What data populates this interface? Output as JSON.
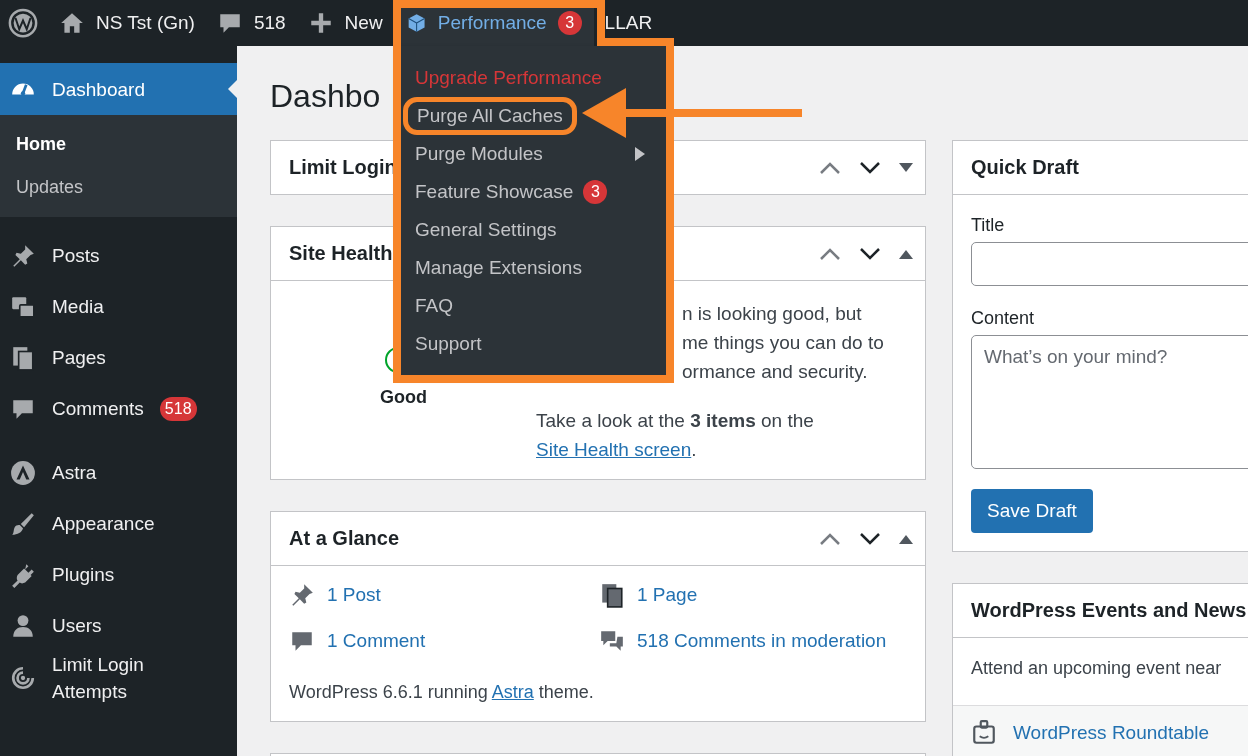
{
  "admin_bar": {
    "items": [
      {
        "kind": "logo"
      },
      {
        "kind": "home",
        "label": "NS Tst (Gn)"
      },
      {
        "kind": "comments",
        "label": "518"
      },
      {
        "kind": "new",
        "label": "New"
      },
      {
        "kind": "performance",
        "label": "Performance",
        "badge": "3"
      },
      {
        "kind": "text",
        "label": "LLAR"
      }
    ]
  },
  "performance_menu": {
    "items": [
      {
        "kind": "upgrade",
        "label": "Upgrade Performance",
        "callout": false
      },
      {
        "kind": "item",
        "label": "Purge All Caches",
        "callout": true
      },
      {
        "kind": "submenu",
        "label": "Purge Modules",
        "callout": false
      },
      {
        "kind": "item",
        "label": "Feature Showcase",
        "badge": "3",
        "callout": false
      },
      {
        "kind": "item",
        "label": "General Settings",
        "callout": false
      },
      {
        "kind": "item",
        "label": "Manage Extensions",
        "callout": false
      },
      {
        "kind": "item",
        "label": "FAQ",
        "callout": false
      },
      {
        "kind": "item",
        "label": "Support",
        "callout": false
      }
    ]
  },
  "sidebar": {
    "groups": [
      [
        {
          "kind": "dashboard",
          "label": "Dashboard",
          "selected": true,
          "children": [
            {
              "label": "Home",
              "selected": true
            },
            {
              "label": "Updates",
              "selected": false
            }
          ]
        }
      ],
      [
        {
          "kind": "pin",
          "label": "Posts",
          "selected": false
        },
        {
          "kind": "media",
          "label": "Media",
          "selected": false
        },
        {
          "kind": "pages",
          "label": "Pages",
          "selected": false
        },
        {
          "kind": "comment",
          "label": "Comments",
          "badge": "518",
          "selected": false
        }
      ],
      [
        {
          "kind": "astra",
          "label": "Astra",
          "selected": false
        },
        {
          "kind": "brush",
          "label": "Appearance",
          "selected": false
        },
        {
          "kind": "plug",
          "label": "Plugins",
          "selected": false
        },
        {
          "kind": "user",
          "label": "Users",
          "selected": false
        },
        {
          "kind": "rings",
          "label": "Limit Login Attempts",
          "selected": false
        }
      ]
    ]
  },
  "page_title": "Dashbo",
  "columns": [
    [
      {
        "kind": "plain",
        "title": "Limit Login",
        "expanded": false
      },
      {
        "kind": "site_health",
        "title": "Site Health",
        "expanded": true,
        "status": "Good",
        "text_lines": [
          "n is looking good, but",
          "me things you can do to",
          "ormance and security."
        ],
        "note": "Take a look at the **3 items** on the ",
        "note_link": "Site Health screen",
        "note_end": "."
      },
      {
        "kind": "glance",
        "title": "At a Glance",
        "expanded": true,
        "items": [
          {
            "kind": "pin",
            "label": "1 Post"
          },
          {
            "kind": "pages",
            "label": "1 Page"
          },
          {
            "kind": "comment",
            "label": "1 Comment"
          },
          {
            "kind": "comments",
            "label": "518 Comments in moderation"
          }
        ],
        "footer": "WordPress 6.6.1 running ",
        "footer_link": "Astra",
        "footer_end": " theme."
      },
      {
        "kind": "blank"
      }
    ],
    [
      {
        "kind": "quick_draft",
        "title": "Quick Draft",
        "title_label": "Title",
        "content_label": "Content",
        "content_placeholder": "What’s on your mind?",
        "button": "Save Draft"
      },
      {
        "kind": "events",
        "title": "WordPress Events and News",
        "intro": "Attend an upcoming event near",
        "events": [
          {
            "label": "WordPress Roundtable"
          }
        ]
      }
    ]
  ]
}
